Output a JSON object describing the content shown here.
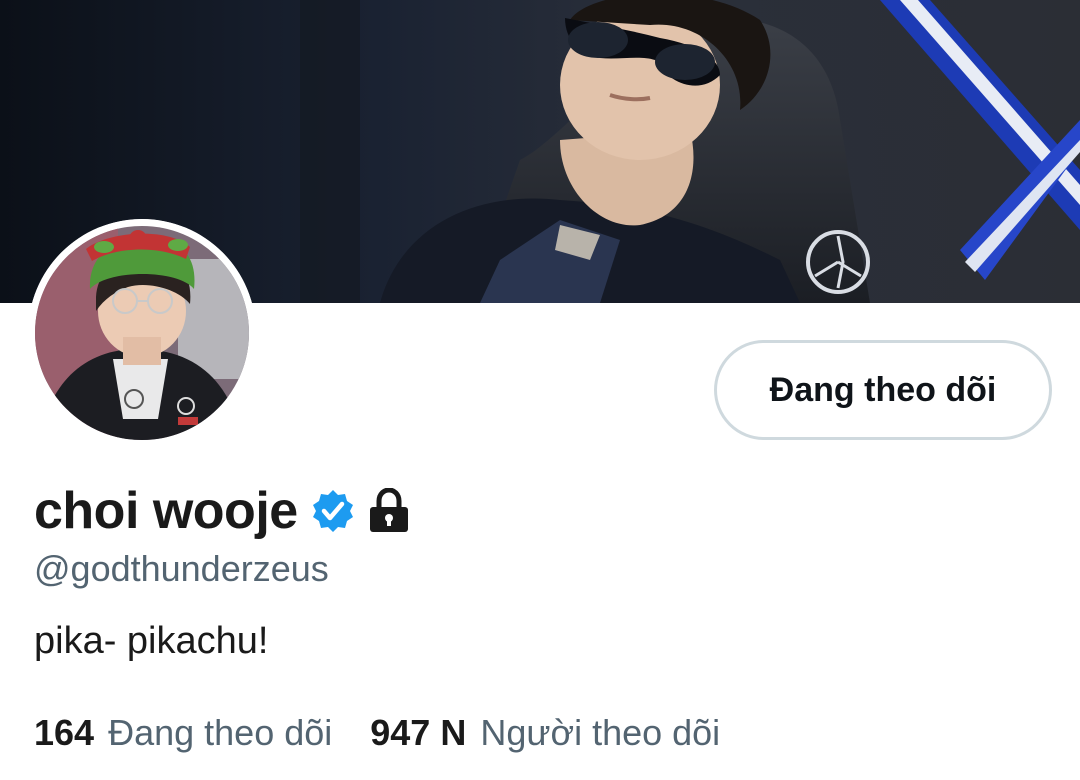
{
  "profile": {
    "display_name": "choi wooje",
    "handle": "@godthunderzeus",
    "bio": "pika- pikachu!",
    "verified": true,
    "protected": true,
    "accent_color": "#1d9bf0"
  },
  "actions": {
    "follow_label": "Đang theo dõi"
  },
  "stats": {
    "following_count": "164",
    "following_label": "Đang theo dõi",
    "followers_count": "947 N",
    "followers_label": "Người theo dõi"
  },
  "icons": {
    "verified": "verified-badge-icon",
    "lock": "lock-icon"
  }
}
